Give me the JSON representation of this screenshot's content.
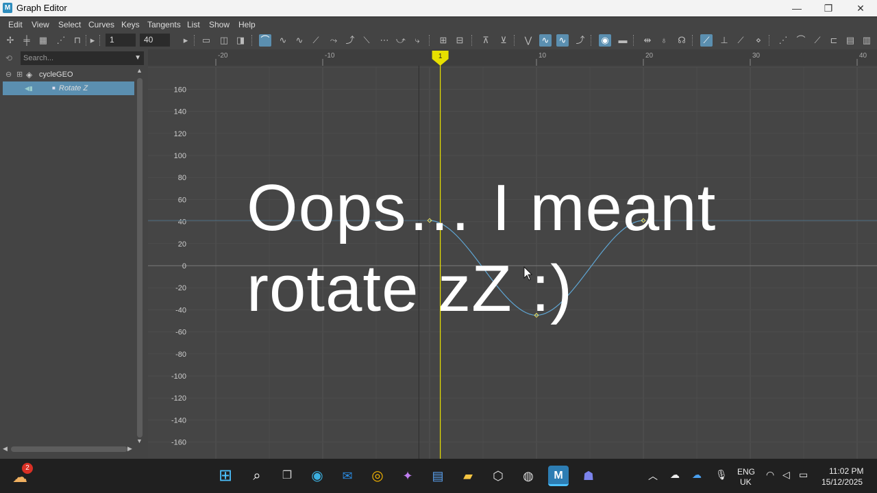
{
  "window": {
    "title": "Graph Editor",
    "minimize": "—",
    "maximize": "❐",
    "close": "✕",
    "app_glyph": "M"
  },
  "menu": [
    "Edit",
    "View",
    "Select",
    "Curves",
    "Keys",
    "Tangents",
    "List",
    "Show",
    "Help"
  ],
  "toolbar": {
    "start_frame": "1",
    "end_frame": "40"
  },
  "outliner": {
    "search_placeholder": "Search...",
    "items": [
      {
        "label": "cycleGEO",
        "expand": "⊖",
        "icon": "cube-icon"
      },
      {
        "label": "Rotate Z",
        "selected": true
      }
    ]
  },
  "graph": {
    "current_frame": "1",
    "x_ticks": [
      -20,
      -10,
      10,
      20,
      30,
      40
    ],
    "y_ticks": [
      160,
      140,
      120,
      100,
      80,
      60,
      40,
      20,
      0,
      -20,
      -40,
      -60,
      -80,
      -100,
      -120,
      -140,
      -160
    ],
    "curve": {
      "name": "Rotate Z",
      "keys": [
        {
          "frame": 0,
          "value": 41
        },
        {
          "frame": 10,
          "value": -45
        },
        {
          "frame": 20,
          "value": 41
        }
      ]
    }
  },
  "overlay": {
    "line1": "Oops… I meant",
    "line2": "rotate zZ :)"
  },
  "taskbar": {
    "weather_badge": "2",
    "lang": "ENG",
    "region": "UK",
    "time": "11:02 PM",
    "date": "15/12/2025"
  },
  "colors": {
    "accent": "#5b8fb0",
    "playhead": "#e8e000",
    "curve": "#5fa6d4"
  }
}
